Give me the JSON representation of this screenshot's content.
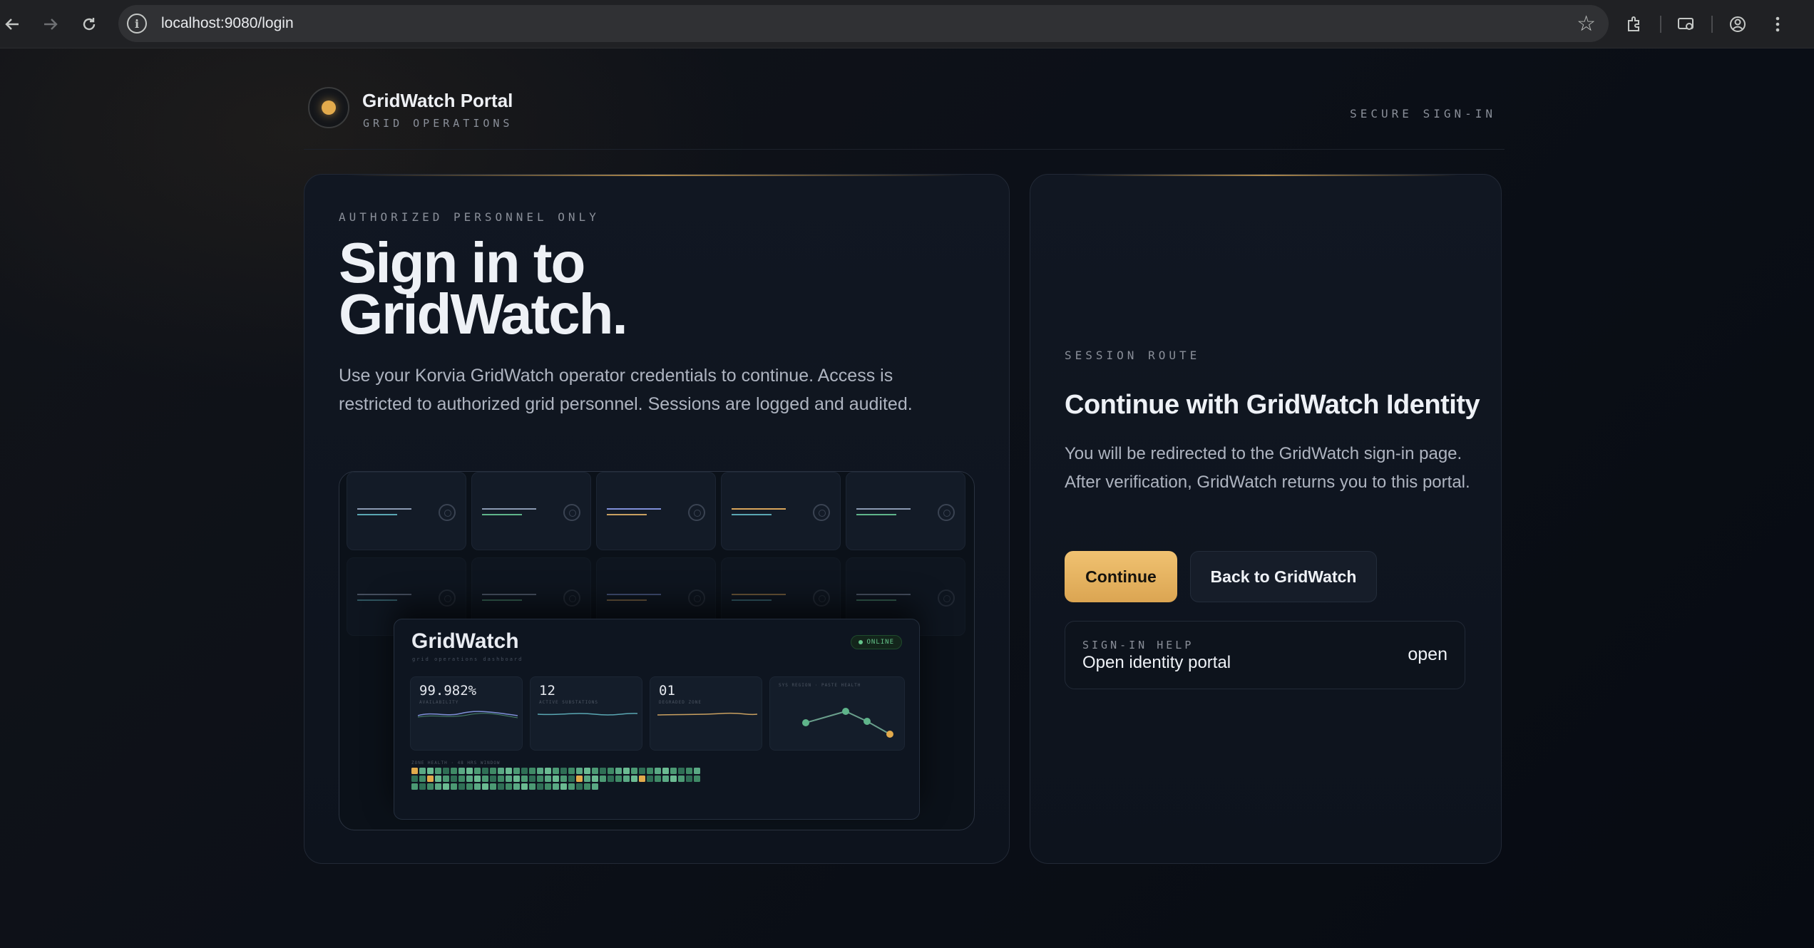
{
  "browser": {
    "url": "localhost:9080/login"
  },
  "header": {
    "brand_name": "GridWatch Portal",
    "brand_sub": "GRID OPERATIONS",
    "right_label": "SECURE SIGN-IN",
    "accent_color": "#e2aa4c"
  },
  "left": {
    "eyebrow": "AUTHORIZED PERSONNEL ONLY",
    "title_line1": "Sign in to",
    "title_line2": "GridWatch.",
    "copy": "Use your Korvia GridWatch operator credentials to continue. Access is restricted to authorized grid personnel. Sessions are logged and audited.",
    "preview": {
      "title": "GridWatch",
      "subtitle": "grid operations dashboard",
      "badge": "ONLINE",
      "kpis": [
        {
          "value": "99.982%",
          "label": "AVAILABILITY"
        },
        {
          "value": "12",
          "label": "ACTIVE SUBSTATIONS"
        },
        {
          "value": "01",
          "label": "DEGRADED ZONE"
        }
      ],
      "chart_label": "SYS REGION · PASTE HEALTH",
      "heat_label": "ZONE HEALTH · 48 HRS WINDOW"
    }
  },
  "right": {
    "eyebrow": "SESSION ROUTE",
    "title": "Continue with GridWatch Identity",
    "copy": "You will be redirected to the GridWatch sign-in page. After verification, GridWatch returns you to this portal.",
    "continue_label": "Continue",
    "back_label": "Back to GridWatch",
    "help_label": "SIGN-IN HELP",
    "help_text": "Open identity portal",
    "help_action": "open"
  }
}
